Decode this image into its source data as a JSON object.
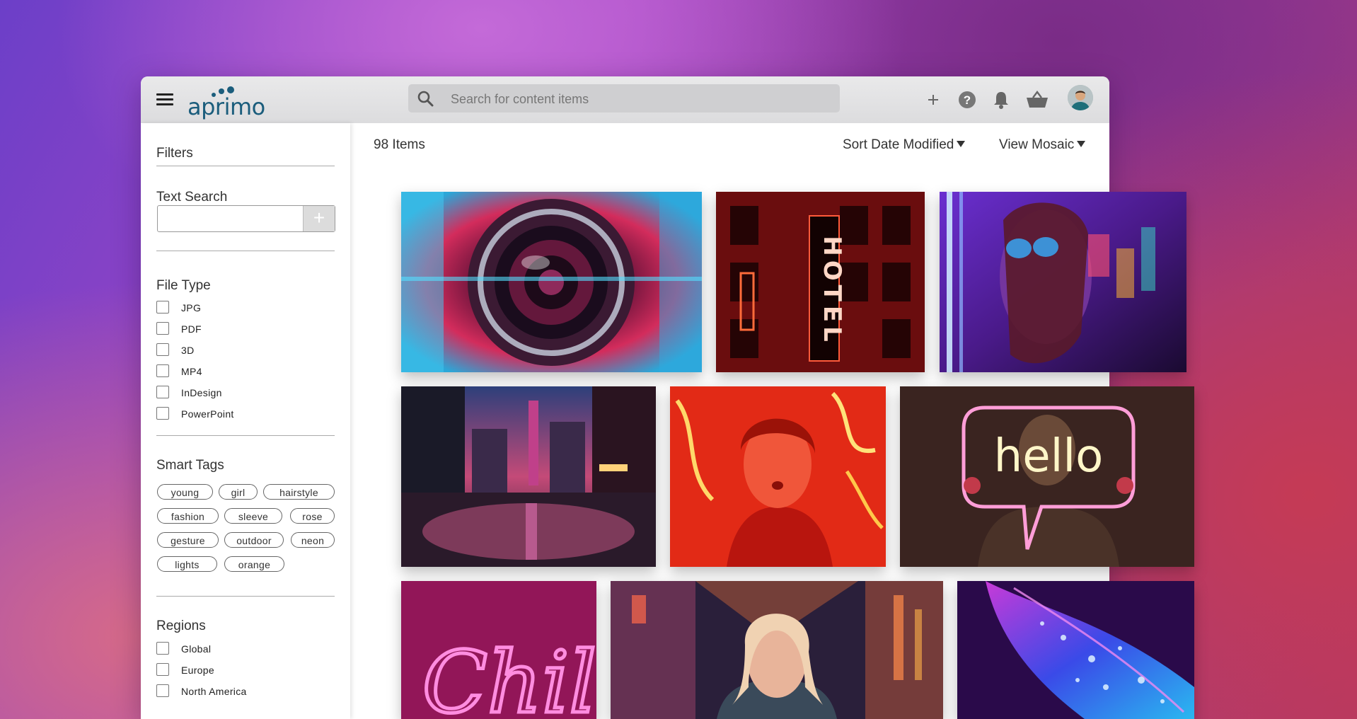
{
  "header": {
    "brand": "aprimo",
    "search_placeholder": "Search for content items"
  },
  "sidebar": {
    "filters_title": "Filters",
    "text_search_title": "Text Search",
    "add_symbol": "+",
    "file_type_title": "File Type",
    "file_types": [
      "JPG",
      "PDF",
      "3D",
      "MP4",
      "InDesign",
      "PowerPoint"
    ],
    "smart_tags_title": "Smart Tags",
    "smart_tags": [
      "young",
      "girl",
      "hairstyle",
      "fashion",
      "sleeve",
      "rose",
      "gesture",
      "outdoor",
      "neon",
      "lights",
      "orange"
    ],
    "regions_title": "Regions",
    "regions": [
      "Global",
      "Europe",
      "North America"
    ]
  },
  "main": {
    "item_count": "98 Items",
    "sort_label": "Sort Date Modified",
    "view_label": "View Mosaic"
  },
  "tile_texts": {
    "hotel": "HOTEL",
    "hello": "hello",
    "chill": "Chill"
  },
  "colors": {
    "brand": "#1b5d7c",
    "neon_pink": "#ff4fd0",
    "neon_red": "#ff2a2a",
    "neon_blue": "#39c8ff"
  }
}
